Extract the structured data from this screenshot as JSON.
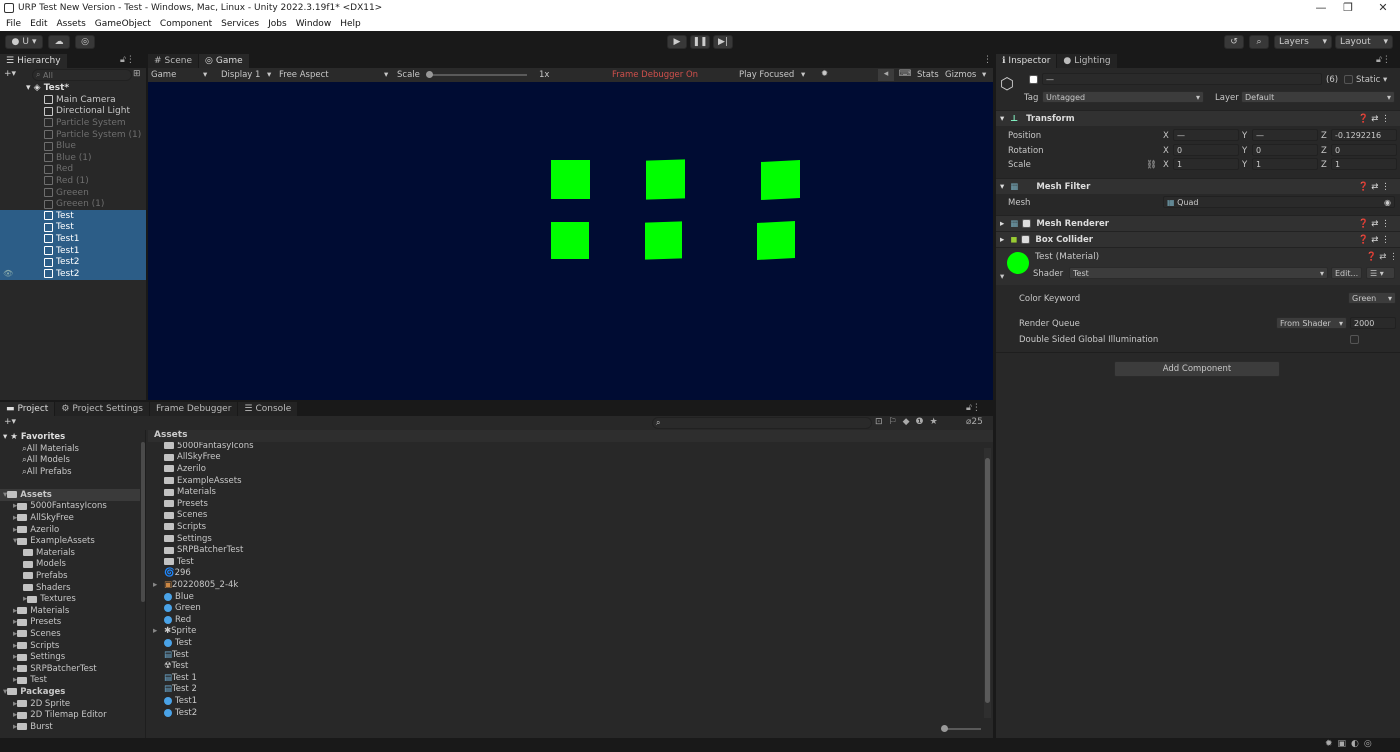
{
  "window": {
    "title": "URP Test New Version - Test - Windows, Mac, Linux - Unity 2022.3.19f1* <DX11>"
  },
  "menu": [
    "File",
    "Edit",
    "Assets",
    "GameObject",
    "Component",
    "Services",
    "Jobs",
    "Window",
    "Help"
  ],
  "toolbar": {
    "account": "U",
    "layers": "Layers",
    "layout": "Layout"
  },
  "hierarchy": {
    "tab": "Hierarchy",
    "search_placeholder": "All",
    "scene": "Test*",
    "items": [
      {
        "label": "Main Camera",
        "state": "normal"
      },
      {
        "label": "Directional Light",
        "state": "normal"
      },
      {
        "label": "Particle System",
        "state": "disabled"
      },
      {
        "label": "Particle System (1)",
        "state": "disabled"
      },
      {
        "label": "Blue",
        "state": "disabled"
      },
      {
        "label": "Blue (1)",
        "state": "disabled"
      },
      {
        "label": "Red",
        "state": "disabled"
      },
      {
        "label": "Red (1)",
        "state": "disabled"
      },
      {
        "label": "Greeen",
        "state": "disabled"
      },
      {
        "label": "Greeen (1)",
        "state": "disabled"
      },
      {
        "label": "Test",
        "state": "selected"
      },
      {
        "label": "Test",
        "state": "selected"
      },
      {
        "label": "Test1",
        "state": "selected"
      },
      {
        "label": "Test1",
        "state": "selected"
      },
      {
        "label": "Test2",
        "state": "selected"
      },
      {
        "label": "Test2",
        "state": "selected"
      }
    ]
  },
  "game": {
    "tabs": [
      "Scene",
      "Game"
    ],
    "mode": "Game",
    "display": "Display 1",
    "aspect": "Free Aspect",
    "scale_label": "Scale",
    "scale_value": "1x",
    "frame_debugger": "Frame Debugger On",
    "play_mode": "Play Focused",
    "stats": "Stats",
    "gizmos": "Gizmos"
  },
  "project": {
    "tabs": [
      "Project",
      "Project Settings",
      "Frame Debugger",
      "Console"
    ],
    "count": "25",
    "favorites_title": "Favorites",
    "favorites": [
      "All Materials",
      "All Models",
      "All Prefabs"
    ],
    "tree": [
      {
        "label": "Assets",
        "level": 0,
        "bold": true
      },
      {
        "label": "5000FantasyIcons",
        "level": 1
      },
      {
        "label": "AllSkyFree",
        "level": 1
      },
      {
        "label": "Azerilo",
        "level": 1
      },
      {
        "label": "ExampleAssets",
        "level": 1
      },
      {
        "label": "Materials",
        "level": 2
      },
      {
        "label": "Models",
        "level": 2
      },
      {
        "label": "Prefabs",
        "level": 2
      },
      {
        "label": "Shaders",
        "level": 2
      },
      {
        "label": "Textures",
        "level": 2
      },
      {
        "label": "Materials",
        "level": 1
      },
      {
        "label": "Presets",
        "level": 1
      },
      {
        "label": "Scenes",
        "level": 1
      },
      {
        "label": "Scripts",
        "level": 1
      },
      {
        "label": "Settings",
        "level": 1
      },
      {
        "label": "SRPBatcherTest",
        "level": 1
      },
      {
        "label": "Test",
        "level": 1
      },
      {
        "label": "Packages",
        "level": 0,
        "bold": true
      },
      {
        "label": "2D Sprite",
        "level": 1
      },
      {
        "label": "2D Tilemap Editor",
        "level": 1
      },
      {
        "label": "Burst",
        "level": 1
      }
    ],
    "breadcrumb": "Assets",
    "files": [
      {
        "label": "5000FantasyIcons",
        "icon": "folder"
      },
      {
        "label": "AllSkyFree",
        "icon": "folder"
      },
      {
        "label": "Azerilo",
        "icon": "folder"
      },
      {
        "label": "ExampleAssets",
        "icon": "folder"
      },
      {
        "label": "Materials",
        "icon": "folder"
      },
      {
        "label": "Presets",
        "icon": "folder"
      },
      {
        "label": "Scenes",
        "icon": "folder"
      },
      {
        "label": "Scripts",
        "icon": "folder"
      },
      {
        "label": "Settings",
        "icon": "folder"
      },
      {
        "label": "SRPBatcherTest",
        "icon": "folder"
      },
      {
        "label": "Test",
        "icon": "folder"
      },
      {
        "label": "296",
        "icon": "swirl"
      },
      {
        "label": "20220805_2-4k",
        "icon": "image"
      },
      {
        "label": "Blue",
        "icon": "material"
      },
      {
        "label": "Green",
        "icon": "material"
      },
      {
        "label": "Red",
        "icon": "material"
      },
      {
        "label": "Sprite",
        "icon": "sprite"
      },
      {
        "label": "Test",
        "icon": "material"
      },
      {
        "label": "Test",
        "icon": "script"
      },
      {
        "label": "Test",
        "icon": "shader"
      },
      {
        "label": "Test 1",
        "icon": "script"
      },
      {
        "label": "Test 2",
        "icon": "script"
      },
      {
        "label": "Test1",
        "icon": "material"
      },
      {
        "label": "Test2",
        "icon": "material"
      }
    ]
  },
  "inspector": {
    "tabs": [
      "Inspector",
      "Lighting"
    ],
    "name": "—",
    "count": "(6)",
    "static": "Static",
    "tag_label": "Tag",
    "tag": "Untagged",
    "layer_label": "Layer",
    "layer": "Default",
    "transform": {
      "title": "Transform",
      "position_label": "Position",
      "rotation_label": "Rotation",
      "scale_label": "Scale",
      "position": {
        "x": "—",
        "y": "—",
        "z": "-0.1292216"
      },
      "rotation": {
        "x": "0",
        "y": "0",
        "z": "0"
      },
      "scale": {
        "x": "1",
        "y": "1",
        "z": "1"
      }
    },
    "mesh_filter": {
      "title": "Mesh Filter",
      "mesh_label": "Mesh",
      "mesh": "Quad"
    },
    "mesh_renderer": {
      "title": "Mesh Renderer"
    },
    "box_collider": {
      "title": "Box Collider"
    },
    "material": {
      "title": "Test (Material)",
      "shader_label": "Shader",
      "shader": "Test",
      "edit": "Edit...",
      "color_keyword_label": "Color Keyword",
      "color_keyword": "Green",
      "render_queue_label": "Render Queue",
      "render_queue_mode": "From Shader",
      "render_queue": "2000",
      "dsgi_label": "Double Sided Global Illumination"
    },
    "add_component": "Add Component"
  },
  "colors": {
    "game_bg": "#000c33",
    "quad": "#00ff00",
    "selection": "#2c5d87"
  }
}
